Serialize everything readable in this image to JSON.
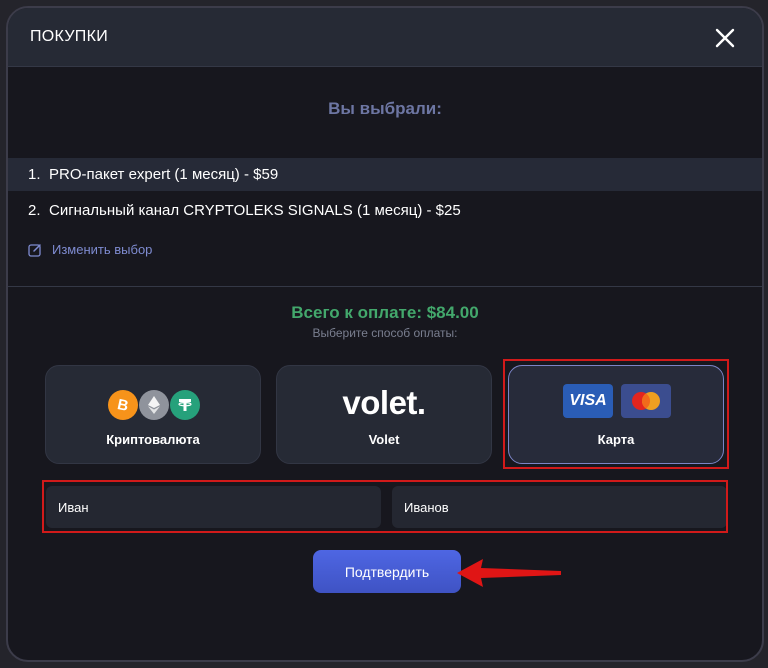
{
  "modal": {
    "title": "ПОКУПКИ",
    "heading": "Вы выбрали:",
    "items": [
      {
        "num": "1.",
        "text": "PRO-пакет expert (1 месяц) - $59"
      },
      {
        "num": "2.",
        "text": "Сигнальный канал CRYPTOLEKS SIGNALS (1 месяц) - $25"
      }
    ],
    "edit_label": "Изменить выбор",
    "total": "Всего к оплате: $84.00",
    "choose_label": "Выберите способ оплаты:"
  },
  "payment_methods": [
    {
      "label": "Криптовалюта",
      "icons": [
        "bitcoin-icon",
        "ethereum-icon",
        "tether-icon"
      ],
      "selected": false
    },
    {
      "label": "Volet",
      "logo": "volet",
      "selected": false
    },
    {
      "label": "Карта",
      "icons": [
        "visa-icon",
        "mastercard-icon"
      ],
      "selected": true
    }
  ],
  "logos": {
    "volet": "volet",
    "visa": "VISA"
  },
  "form": {
    "first_name": "Иван",
    "last_name": "Иванов"
  },
  "confirm_label": "Подтвердить",
  "colors": {
    "accent": "#4e66e3",
    "total_green": "#43a86c",
    "heading": "#6d76a3",
    "link": "#7e8bd0",
    "highlight": "#d11a1a"
  }
}
